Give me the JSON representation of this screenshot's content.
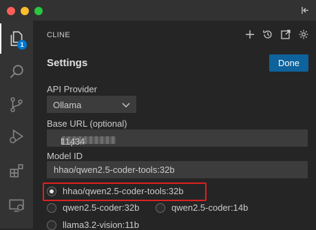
{
  "sidebar_badge": "1",
  "panel": {
    "title": "CLINE",
    "settings_title": "Settings",
    "done_label": "Done"
  },
  "api_provider": {
    "label": "API Provider",
    "selected": "Ollama"
  },
  "base_url": {
    "label": "Base URL (optional)",
    "prefix": "http://",
    "suffix": "11434"
  },
  "model_id": {
    "label": "Model ID",
    "value": "hhao/qwen2.5-coder-tools:32b"
  },
  "models": [
    {
      "label": "hhao/qwen2.5-coder-tools:32b",
      "selected": true
    },
    {
      "label": "qwen2.5-coder:32b",
      "selected": false
    },
    {
      "label": "qwen2.5-coder:14b",
      "selected": false
    },
    {
      "label": "llama3.2-vision:11b",
      "selected": false
    }
  ],
  "colors": {
    "accent": "#0e639c",
    "highlight": "#e0201f",
    "badge": "#0078d4"
  }
}
